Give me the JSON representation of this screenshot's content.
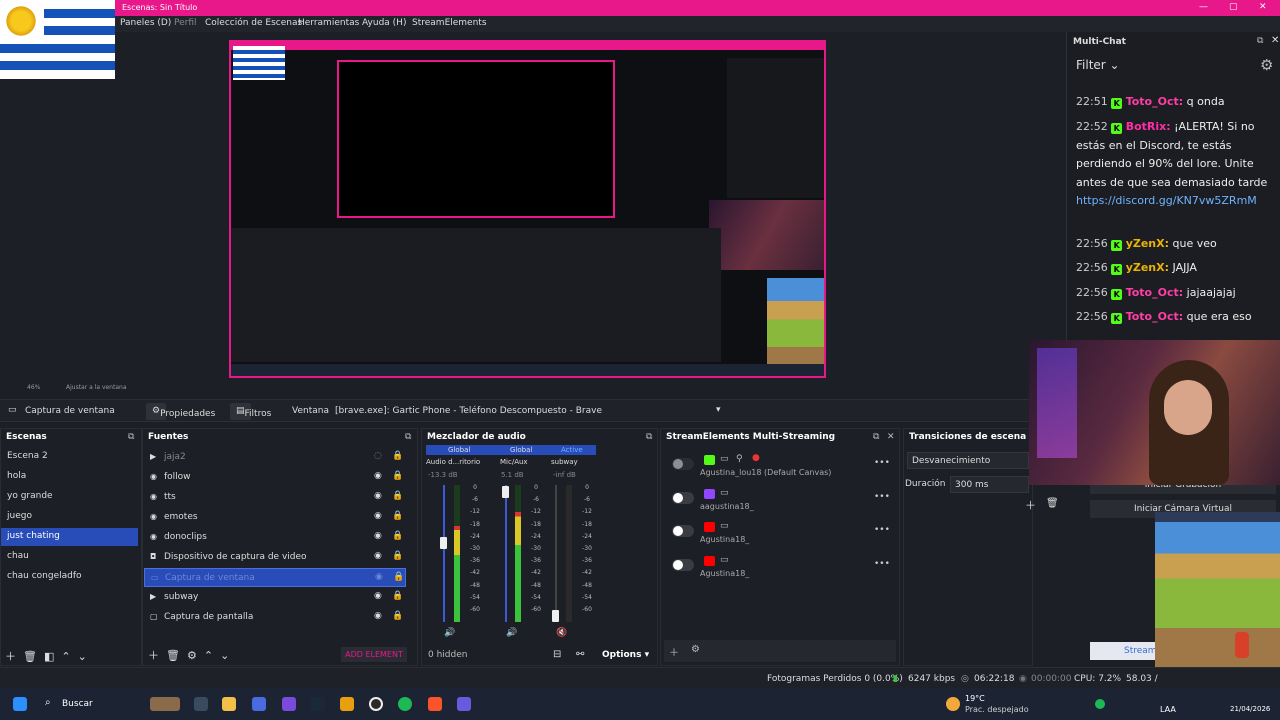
{
  "window": {
    "title": "Escenas: Sin Título"
  },
  "menu": [
    "Paneles (D)",
    "Perfil",
    "Colección de Escenas",
    "Herramientas",
    "Ayuda (H)",
    "StreamElements"
  ],
  "chat": {
    "title": "Multi-Chat",
    "filter": "Filter",
    "messages": [
      {
        "time": "22:51",
        "user": "Toto_Oct:",
        "text": " q onda"
      },
      {
        "time": "22:52",
        "user": "BotRix:",
        "text": " ¡ALERTA! Si no estás en el Discord, te estás perdiendo el 90% del lore. Unite antes de que sea demasiado tarde",
        "link": "https://discord.gg/KN7vw5ZRmM"
      },
      {
        "time": "22:56",
        "user": "yZenX:",
        "text": " que veo"
      },
      {
        "time": "22:56",
        "user": "yZenX:",
        "text": " JAJJA"
      },
      {
        "time": "22:56",
        "user": "Toto_Oct:",
        "text": " jajaajajaj"
      },
      {
        "time": "22:56",
        "user": "Toto_Oct:",
        "text": " que era eso"
      }
    ]
  },
  "zoom": {
    "level": "46%",
    "fit": "Ajustar a la ventana"
  },
  "toolbar": {
    "source": "Captura de ventana",
    "properties": "Propiedades",
    "filters": "Filtros",
    "window_label": "Ventana",
    "window_value": "[brave.exe]: Gartic Phone - Teléfono Descompuesto - Brave"
  },
  "scenes": {
    "title": "Escenas",
    "items": [
      "Escena 2",
      "hola",
      "yo grande",
      "juego",
      "just chating",
      "chau",
      "chau congeladfo"
    ],
    "selected": 4
  },
  "sources": {
    "title": "Fuentes",
    "items": [
      "jaja2",
      "follow",
      "tts",
      "emotes",
      "donoclips",
      "Dispositivo de captura de video",
      "Captura de ventana",
      "subway",
      "Captura de pantalla"
    ],
    "selected": 6,
    "add_label": "ADD ELEMENT"
  },
  "mixer": {
    "title": "Mezclador de audio",
    "channels": [
      {
        "tag": "Global",
        "name": "Audio d...ritorio",
        "db": "-13.3 dB",
        "level": 0.7
      },
      {
        "tag": "Global",
        "name": "Mic/Aux",
        "db": "5.1 dB",
        "level": 0.8
      },
      {
        "tag": "Active",
        "name": "subway",
        "db": "-inf dB",
        "level": 0
      }
    ],
    "scale": [
      "0",
      "-6",
      "-12",
      "-18",
      "-24",
      "-30",
      "-36",
      "-42",
      "-48",
      "-54",
      "-60"
    ],
    "hidden": "0 hidden",
    "options": "Options"
  },
  "multistream": {
    "title": "StreamElements Multi-Streaming",
    "rows": [
      {
        "name": "Agustina_lou18 (Default Canvas)",
        "platform": "kick"
      },
      {
        "name": "aagustina18_",
        "platform": "twitch"
      },
      {
        "name": "Agustina18_",
        "platform": "youtube"
      },
      {
        "name": "Agustina18_",
        "platform": "youtube"
      }
    ]
  },
  "transitions": {
    "title": "Transiciones de escena",
    "type": "Desvanecimiento",
    "duration_label": "Duración",
    "duration": "300 ms"
  },
  "controls": {
    "record": "Iniciar Grabación",
    "virtual_cam": "Iniciar Cámara Virtual",
    "stream": "Stream"
  },
  "status": {
    "dropped": "Fotogramas Perdidos 0 (0.0%)",
    "kbps": "6247 kbps",
    "live": "06:22:18",
    "rec": "00:00:00",
    "cpu": "CPU: 7.2%",
    "fps": "58.03 /"
  },
  "taskbar": {
    "search": "Buscar",
    "weather_temp": "19°C",
    "weather_desc": "Prac. despejado",
    "lang": "LAA",
    "date": "21/04/2026"
  },
  "colors": {
    "accent": "#e8188a",
    "selection": "#284cb8",
    "kick": "#53fc18",
    "twitch": "#9146ff",
    "youtube": "#ff0000"
  }
}
